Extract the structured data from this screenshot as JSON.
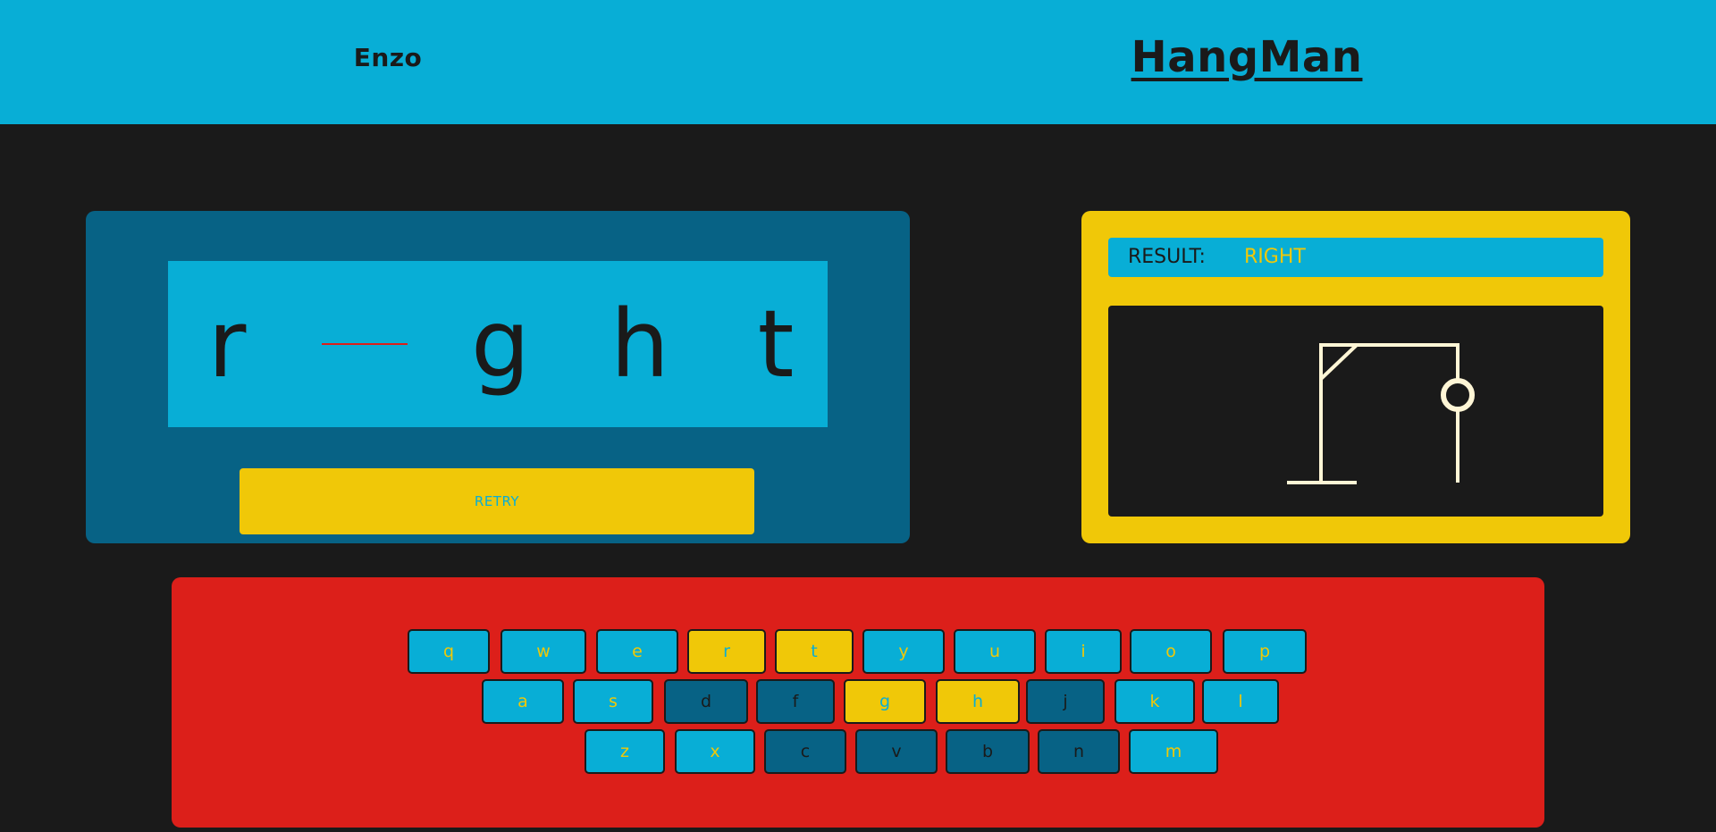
{
  "header": {
    "player_name": "Enzo",
    "title": "HangMan"
  },
  "word": {
    "letters": [
      {
        "char": "r",
        "revealed": true
      },
      {
        "char": "",
        "revealed": false
      },
      {
        "char": "g",
        "revealed": true
      },
      {
        "char": "h",
        "revealed": true
      },
      {
        "char": "t",
        "revealed": true
      }
    ]
  },
  "actions": {
    "retry_label": "RETRY"
  },
  "result": {
    "label": "RESULT:",
    "value": "RIGHT"
  },
  "hangman": {
    "stage_parts_shown": [
      "base",
      "pole",
      "beam",
      "brace",
      "rope",
      "head"
    ]
  },
  "keyboard": {
    "rows": [
      [
        {
          "key": "q",
          "state": "unused"
        },
        {
          "key": "w",
          "state": "unused"
        },
        {
          "key": "e",
          "state": "unused"
        },
        {
          "key": "r",
          "state": "correct"
        },
        {
          "key": "t",
          "state": "correct"
        },
        {
          "key": "y",
          "state": "unused"
        },
        {
          "key": "u",
          "state": "unused"
        },
        {
          "key": "i",
          "state": "unused"
        },
        {
          "key": "o",
          "state": "unused"
        },
        {
          "key": "p",
          "state": "unused"
        }
      ],
      [
        {
          "key": "a",
          "state": "unused"
        },
        {
          "key": "s",
          "state": "unused"
        },
        {
          "key": "d",
          "state": "wrong"
        },
        {
          "key": "f",
          "state": "wrong"
        },
        {
          "key": "g",
          "state": "correct"
        },
        {
          "key": "h",
          "state": "correct"
        },
        {
          "key": "j",
          "state": "wrong"
        },
        {
          "key": "k",
          "state": "unused"
        },
        {
          "key": "l",
          "state": "unused"
        }
      ],
      [
        {
          "key": "z",
          "state": "unused"
        },
        {
          "key": "x",
          "state": "unused"
        },
        {
          "key": "c",
          "state": "wrong"
        },
        {
          "key": "v",
          "state": "wrong"
        },
        {
          "key": "b",
          "state": "wrong"
        },
        {
          "key": "n",
          "state": "wrong"
        },
        {
          "key": "m",
          "state": "unused"
        }
      ]
    ]
  },
  "colors": {
    "header_bg": "#08aed6",
    "page_bg": "#1a1a1a",
    "word_panel_bg": "#076285",
    "result_panel_bg": "#f0c808",
    "keyboard_bg": "#dc1f1a",
    "blank_underline": "#dc1f1a",
    "gallows_stroke": "#fff6d6"
  }
}
